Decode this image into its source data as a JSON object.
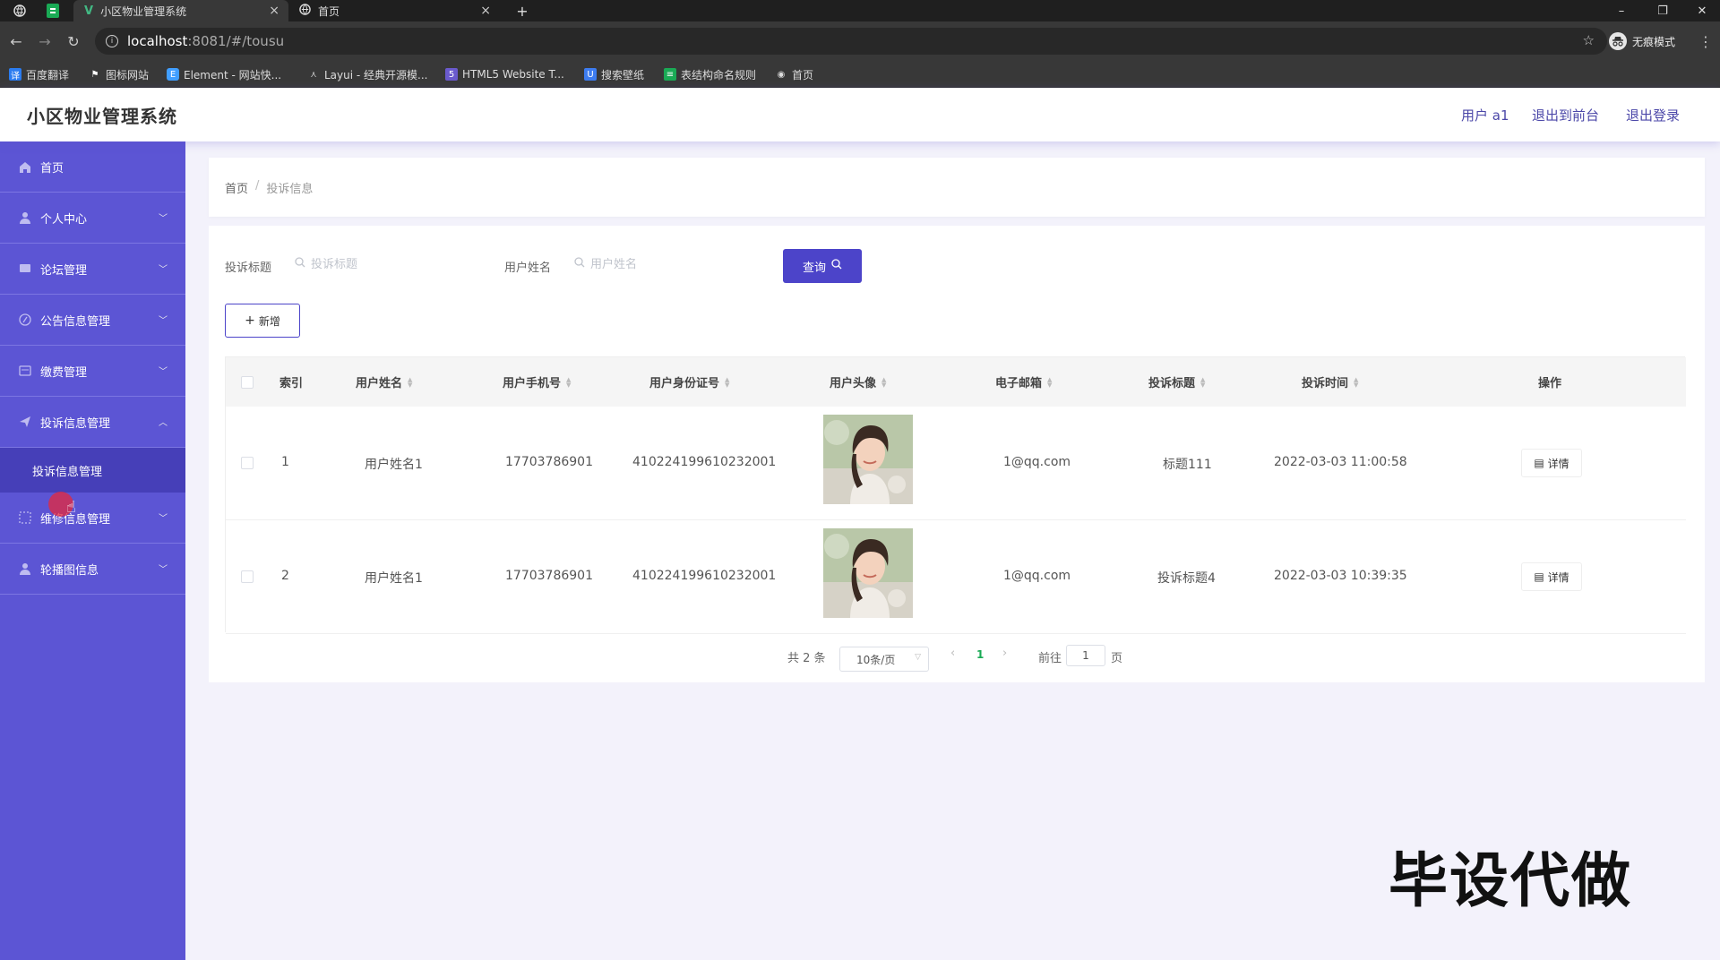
{
  "browser": {
    "tabs": [
      {
        "label": "小区物业管理系统",
        "active": true
      },
      {
        "label": "首页",
        "active": false
      }
    ],
    "url_host": "localhost",
    "url_rest": ":8081/#/tousu",
    "incognito_label": "无痕模式",
    "bookmarks": [
      {
        "label": "百度翻译",
        "icon": "translate-icon",
        "color": "#2b7cf0"
      },
      {
        "label": "图标网站",
        "icon": "flag-icon",
        "color": "#333333"
      },
      {
        "label": "Element - 网站快...",
        "icon": "element-icon",
        "color": "#409eff"
      },
      {
        "label": "Layui - 经典开源模...",
        "icon": "layui-icon",
        "color": "#5fb878"
      },
      {
        "label": "HTML5 Website T...",
        "icon": "html5-icon",
        "color": "#6a5acd"
      },
      {
        "label": "搜索壁纸",
        "icon": "wallpaper-icon",
        "color": "#3d7cf0"
      },
      {
        "label": "表结构命名规则",
        "icon": "doc-icon",
        "color": "#1aaa55"
      },
      {
        "label": "首页",
        "icon": "globe-icon",
        "color": "#888888"
      }
    ]
  },
  "header": {
    "title": "小区物业管理系统",
    "user": "用户 a1",
    "front": "退出到前台",
    "logout": "退出登录"
  },
  "sidebar": {
    "items": [
      {
        "label": "首页",
        "icon": "home-icon",
        "expandable": false
      },
      {
        "label": "个人中心",
        "icon": "user-icon",
        "expandable": true
      },
      {
        "label": "论坛管理",
        "icon": "forum-icon",
        "expandable": true
      },
      {
        "label": "公告信息管理",
        "icon": "notice-icon",
        "expandable": true
      },
      {
        "label": "缴费管理",
        "icon": "payment-icon",
        "expandable": true
      },
      {
        "label": "投诉信息管理",
        "icon": "complaint-icon",
        "expandable": true,
        "open": true
      },
      {
        "label": "维修信息管理",
        "icon": "repair-icon",
        "expandable": true
      },
      {
        "label": "轮播图信息",
        "icon": "carousel-icon",
        "expandable": true
      }
    ],
    "sub_item": "投诉信息管理"
  },
  "breadcrumb": {
    "home": "首页",
    "sep": "/",
    "current": "投诉信息"
  },
  "filters": {
    "title_label": "投诉标题",
    "title_placeholder": "投诉标题",
    "name_label": "用户姓名",
    "name_placeholder": "用户姓名",
    "query_button": "查询",
    "add_button": "新增"
  },
  "table": {
    "columns": [
      "索引",
      "用户姓名",
      "用户手机号",
      "用户身份证号",
      "用户头像",
      "电子邮箱",
      "投诉标题",
      "投诉时间",
      "操作"
    ],
    "rows": [
      {
        "index": "1",
        "name": "用户姓名1",
        "phone": "17703786901",
        "idcard": "410224199610232001",
        "email": "1@qq.com",
        "title": "标题111",
        "time": "2022-03-03 11:00:58",
        "action": "详情"
      },
      {
        "index": "2",
        "name": "用户姓名1",
        "phone": "17703786901",
        "idcard": "410224199610232001",
        "email": "1@qq.com",
        "title": "投诉标题4",
        "time": "2022-03-03 10:39:35",
        "action": "详情"
      }
    ]
  },
  "pagination": {
    "total": "共 2 条",
    "page_size": "10条/页",
    "current_page": "1",
    "goto_label": "前往",
    "goto_value": "1",
    "page_unit": "页"
  },
  "watermark": "毕设代做",
  "colors": {
    "accent": "#5c55d4",
    "accent_dark": "#463fb8",
    "button": "#4c44c9"
  }
}
